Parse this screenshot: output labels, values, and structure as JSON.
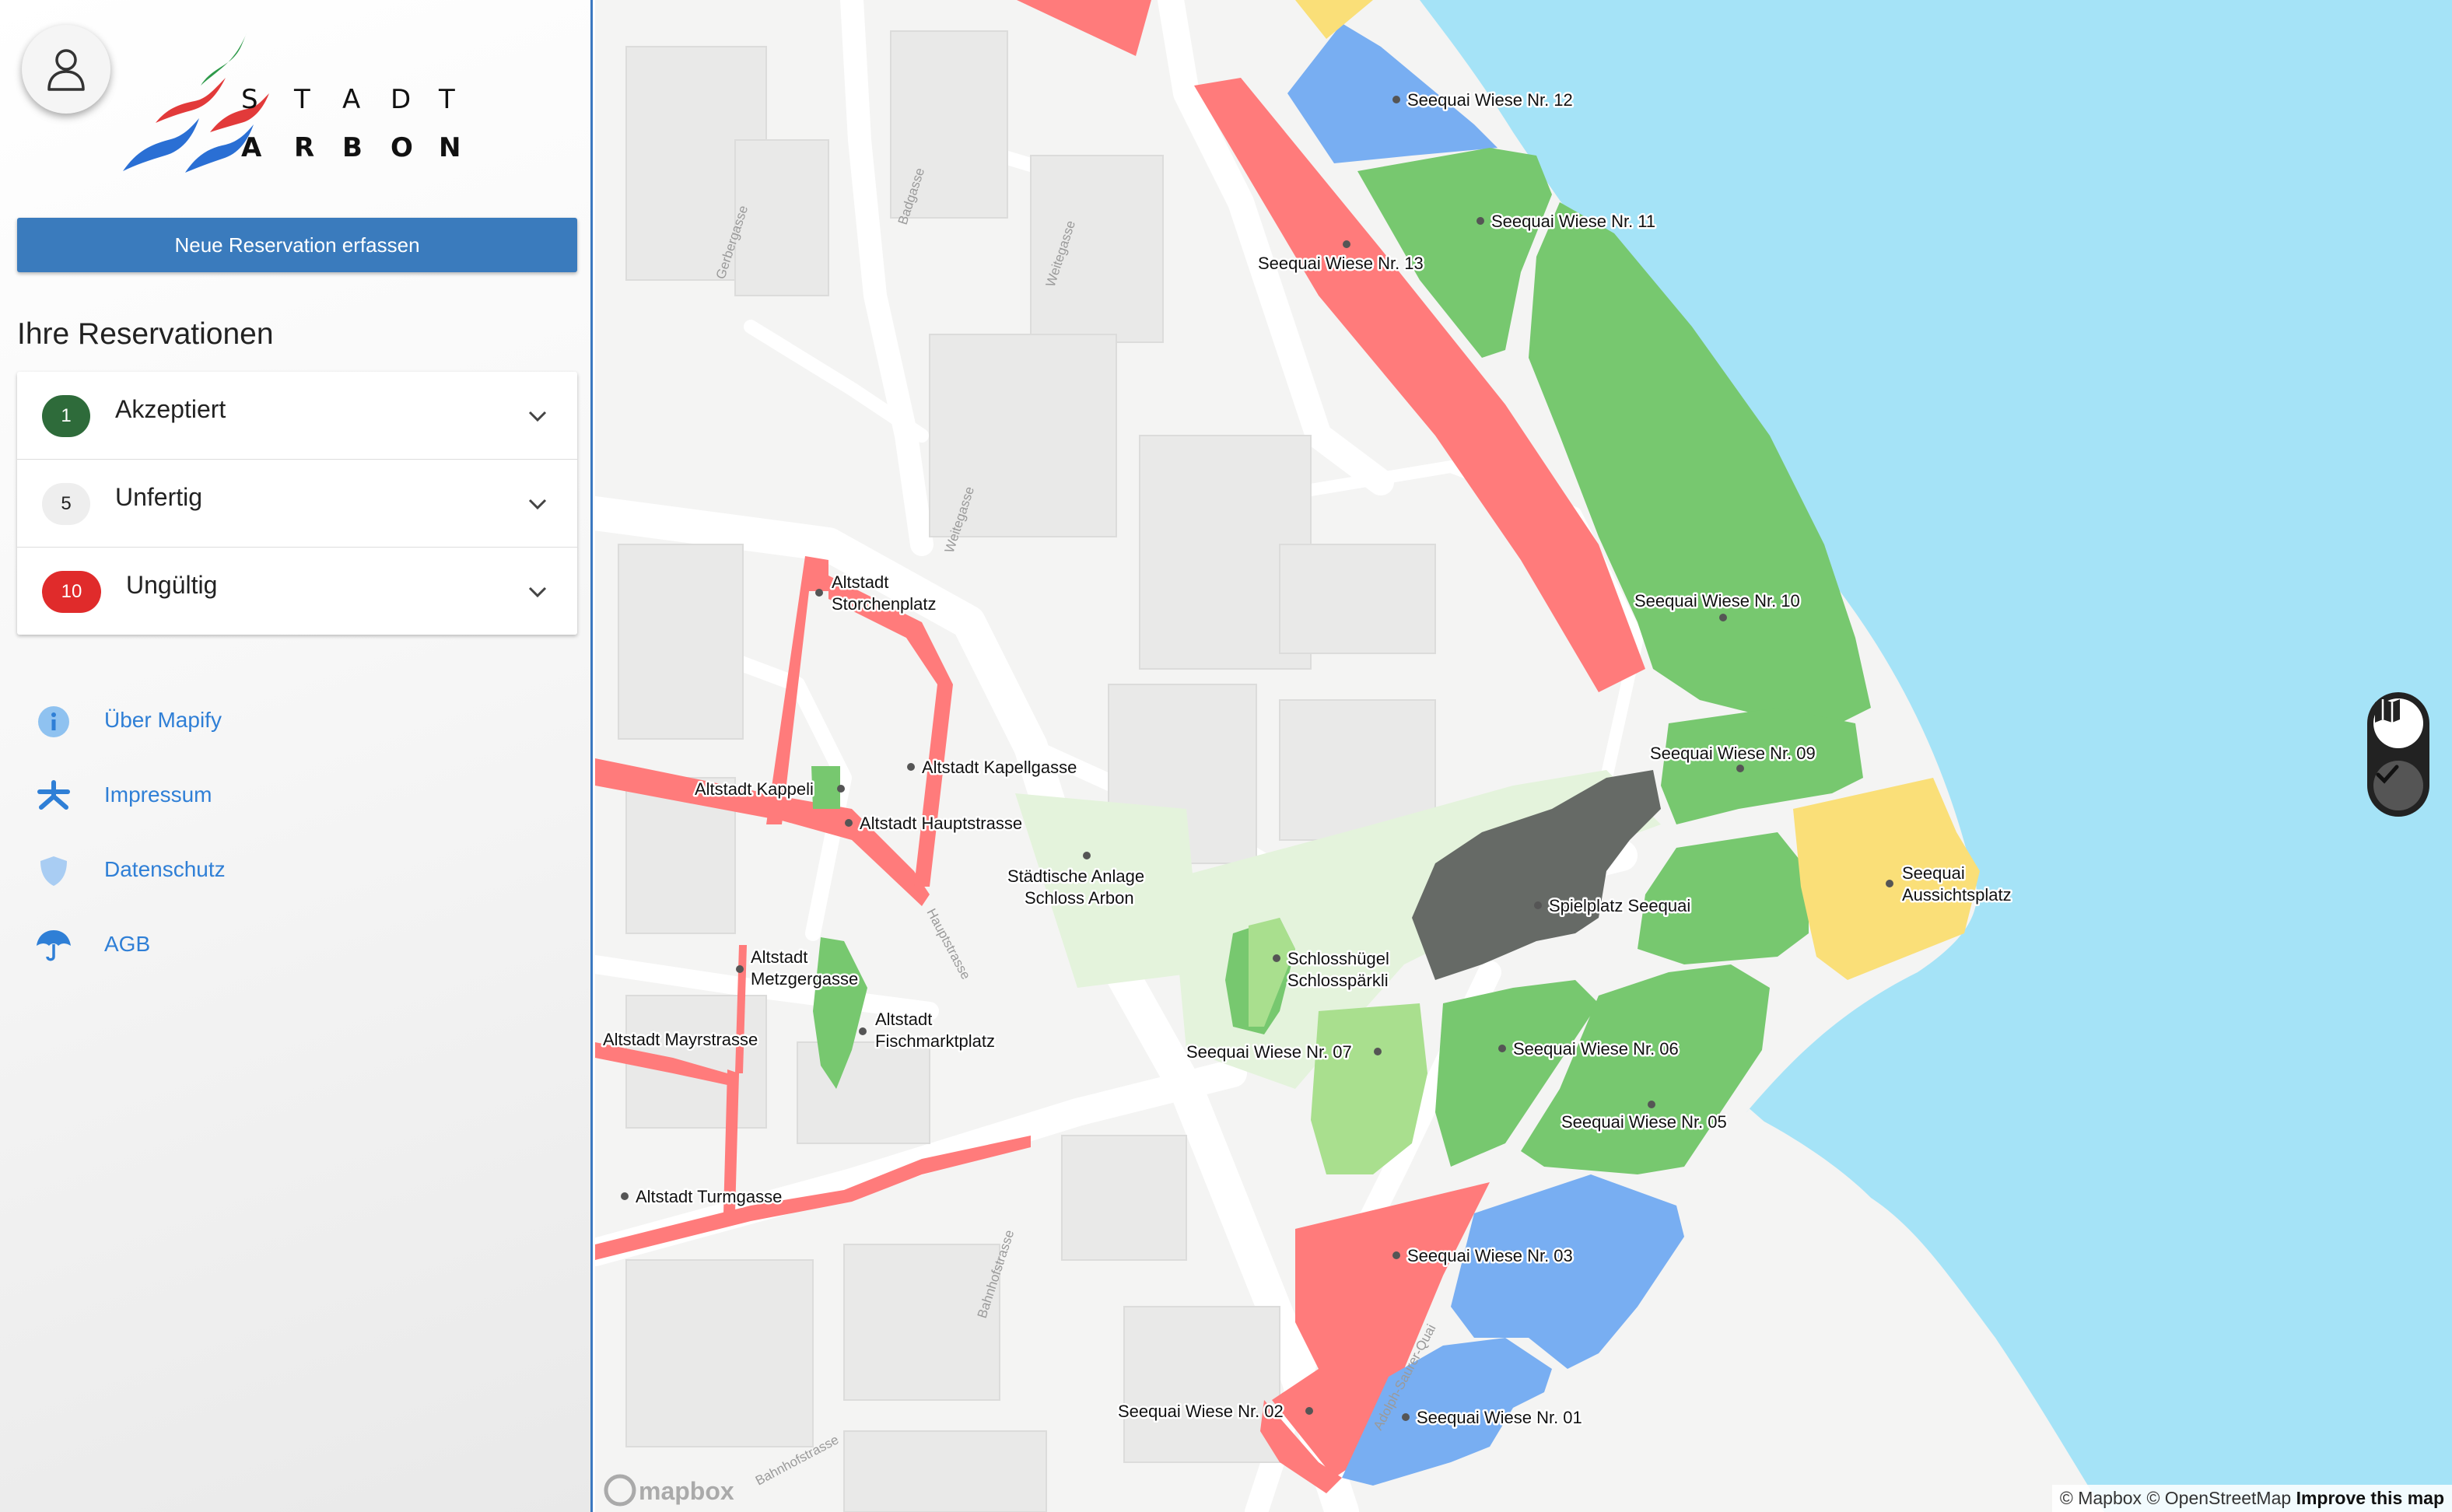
{
  "logo": {
    "line1": [
      "S",
      "T",
      "A",
      "D",
      "T"
    ],
    "line2": [
      "A",
      "R",
      "B",
      "O",
      "N"
    ]
  },
  "sidebar": {
    "new_reservation_label": "Neue Reservation erfassen",
    "reservations_title": "Ihre Reservationen",
    "groups": [
      {
        "count": "1",
        "label": "Akzeptiert",
        "color": "#2e6b3a"
      },
      {
        "count": "5",
        "label": "Unfertig",
        "color": "#eeeeee"
      },
      {
        "count": "10",
        "label": "Ungültig",
        "color": "#e02b2b"
      }
    ],
    "links": [
      {
        "label": "Über Mapify",
        "icon": "info-icon"
      },
      {
        "label": "Impressum",
        "icon": "asterisk-icon"
      },
      {
        "label": "Datenschutz",
        "icon": "shield-icon"
      },
      {
        "label": "AGB",
        "icon": "umbrella-icon"
      }
    ]
  },
  "map": {
    "zones": [
      {
        "label": "Seequai Wiese Nr. 12",
        "status": "blue"
      },
      {
        "label": "Seequai Wiese Nr. 11",
        "status": "green"
      },
      {
        "label": "Seequai Wiese Nr. 13",
        "status": "red"
      },
      {
        "label": "Seequai Wiese Nr. 10",
        "status": "green"
      },
      {
        "label": "Seequai Wiese Nr. 09",
        "status": "green"
      },
      {
        "label": "Seequai",
        "label2": "Aussichtsplatz",
        "status": "yellow"
      },
      {
        "label": "Spielplatz Seequai",
        "status": "gray"
      },
      {
        "label": "Schlosshügel",
        "label2": "Schlosspärkli",
        "status": "green"
      },
      {
        "label": "Seequai Wiese Nr. 07",
        "status": "lightgreen"
      },
      {
        "label": "Seequai Wiese Nr. 06",
        "status": "green"
      },
      {
        "label": "Seequai Wiese Nr. 05",
        "status": "green"
      },
      {
        "label": "Seequai Wiese Nr. 03",
        "status": "blue"
      },
      {
        "label": "Seequai Wiese Nr. 02",
        "status": "red"
      },
      {
        "label": "Seequai Wiese Nr. 01",
        "status": "blue"
      },
      {
        "label": "Altstadt",
        "label2": "Storchenplatz",
        "status": "red"
      },
      {
        "label": "Altstadt Kapellgasse",
        "status": "red"
      },
      {
        "label": "Altstadt Kappeli",
        "status": "green"
      },
      {
        "label": "Altstadt Hauptstrasse",
        "status": "red"
      },
      {
        "label": "Städtische Anlage",
        "label2": "Schloss Arbon",
        "status": "lightgreen"
      },
      {
        "label": "Altstadt",
        "label2": "Metzgergasse",
        "status": "green"
      },
      {
        "label": "Altstadt",
        "label2": "Fischmarktplatz",
        "status": "green"
      },
      {
        "label": "Altstadt Mayrstrasse",
        "status": "red"
      },
      {
        "label": "Altstadt Turmgasse",
        "status": "red"
      }
    ],
    "streets": [
      "Gerbergasse",
      "Badgasse",
      "Weitegasse",
      "Weitegasse",
      "Hauptstrasse",
      "Bahnhofstrasse",
      "Bahnhofstrasse",
      "Adolph-Saurer-Quai"
    ],
    "attribution": {
      "mapbox": "© Mapbox",
      "osm": "© OpenStreetMap",
      "improve": "Improve this map"
    },
    "wordmark": "mapbox"
  },
  "colors": {
    "red": "#ff7b7b",
    "green": "#77c86f",
    "lightgreen": "#a9df8e",
    "blue": "#78aef2",
    "yellow": "#fadf78",
    "gray": "#666a66",
    "water": "#a5e3f7",
    "accent": "#3a7bbd"
  }
}
